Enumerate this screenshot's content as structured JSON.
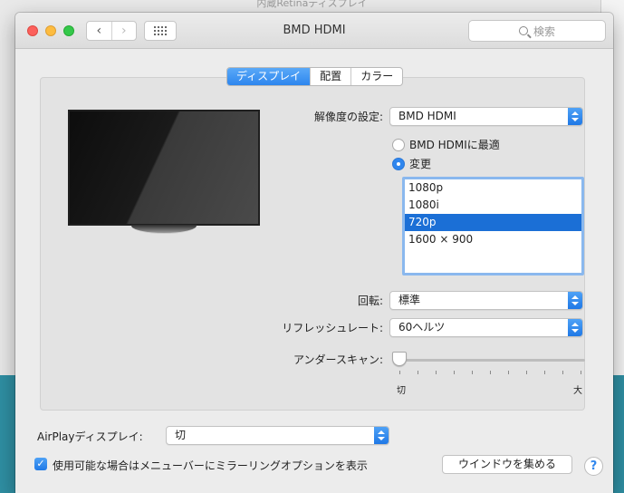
{
  "background_window": {
    "title": "内蔵Retinaディスプレイ"
  },
  "window": {
    "title": "BMD HDMI",
    "nav": {
      "back": "‹",
      "forward": "›",
      "grid_icon": "grid-icon"
    },
    "search": {
      "placeholder": "検索"
    }
  },
  "tabs": [
    {
      "label": "ディスプレイ",
      "active": true
    },
    {
      "label": "配置",
      "active": false
    },
    {
      "label": "カラー",
      "active": false
    }
  ],
  "display": {
    "resolution_label": "解像度の設定:",
    "resolution_value": "BMD HDMI",
    "radio_best": "BMD HDMIに最適",
    "radio_scaled": "変更",
    "resolutions": [
      "1080p",
      "1080i",
      "720p",
      "1600 × 900"
    ],
    "selected_resolution": "720p",
    "rotation_label": "回転:",
    "rotation_value": "標準",
    "refresh_label": "リフレッシュレート:",
    "refresh_value": "60ヘルツ",
    "underscan_label": "アンダースキャン:",
    "underscan_min": "切",
    "underscan_max": "大",
    "underscan_level": 0
  },
  "footer": {
    "airplay_label": "AirPlayディスプレイ:",
    "airplay_value": "切",
    "mirror_checkbox": "使用可能な場合はメニューバーにミラーリングオプションを表示",
    "mirror_checked": true,
    "gather_button": "ウインドウを集める",
    "help": "?"
  },
  "colors": {
    "accent": "#2f86ee",
    "selection": "#1b6fd6"
  }
}
